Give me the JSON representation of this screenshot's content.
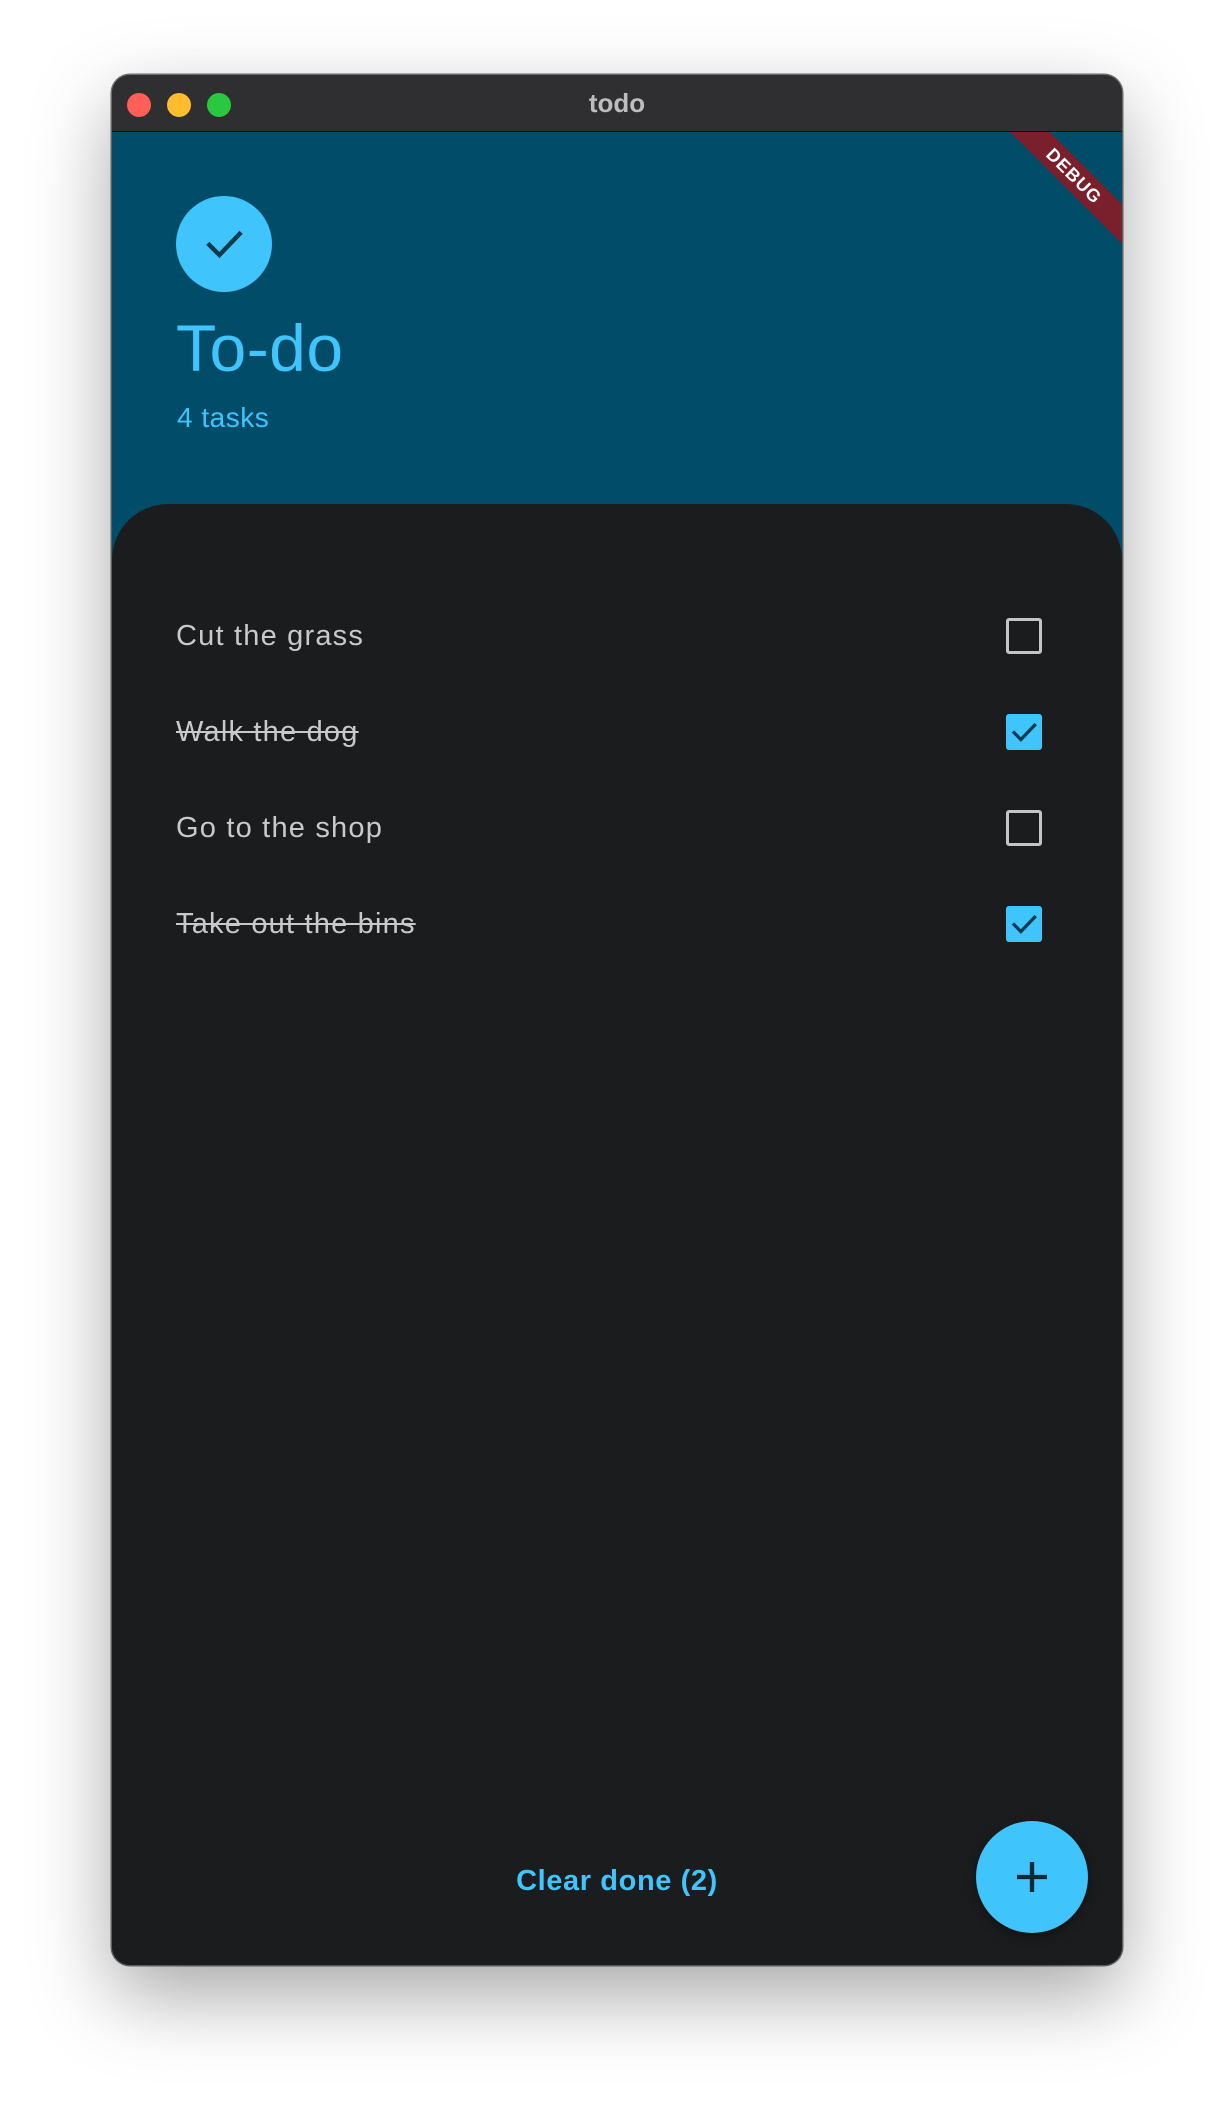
{
  "window": {
    "title": "todo"
  },
  "header": {
    "title": "To-do",
    "subtitle": "4 tasks",
    "debug_banner": "DEBUG",
    "avatar_icon": "check-icon"
  },
  "tasks": [
    {
      "label": "Cut the grass",
      "done": false
    },
    {
      "label": "Walk the dog",
      "done": true
    },
    {
      "label": "Go to the shop",
      "done": false
    },
    {
      "label": "Take out the bins",
      "done": true
    }
  ],
  "footer": {
    "clear_label": "Clear done (2)",
    "fab_icon": "plus-icon"
  },
  "colors": {
    "accent": "#3fc4fc",
    "header_bg": "#004c69",
    "body_bg": "#1b1c1e",
    "debug_banner": "#7a1f2c"
  }
}
